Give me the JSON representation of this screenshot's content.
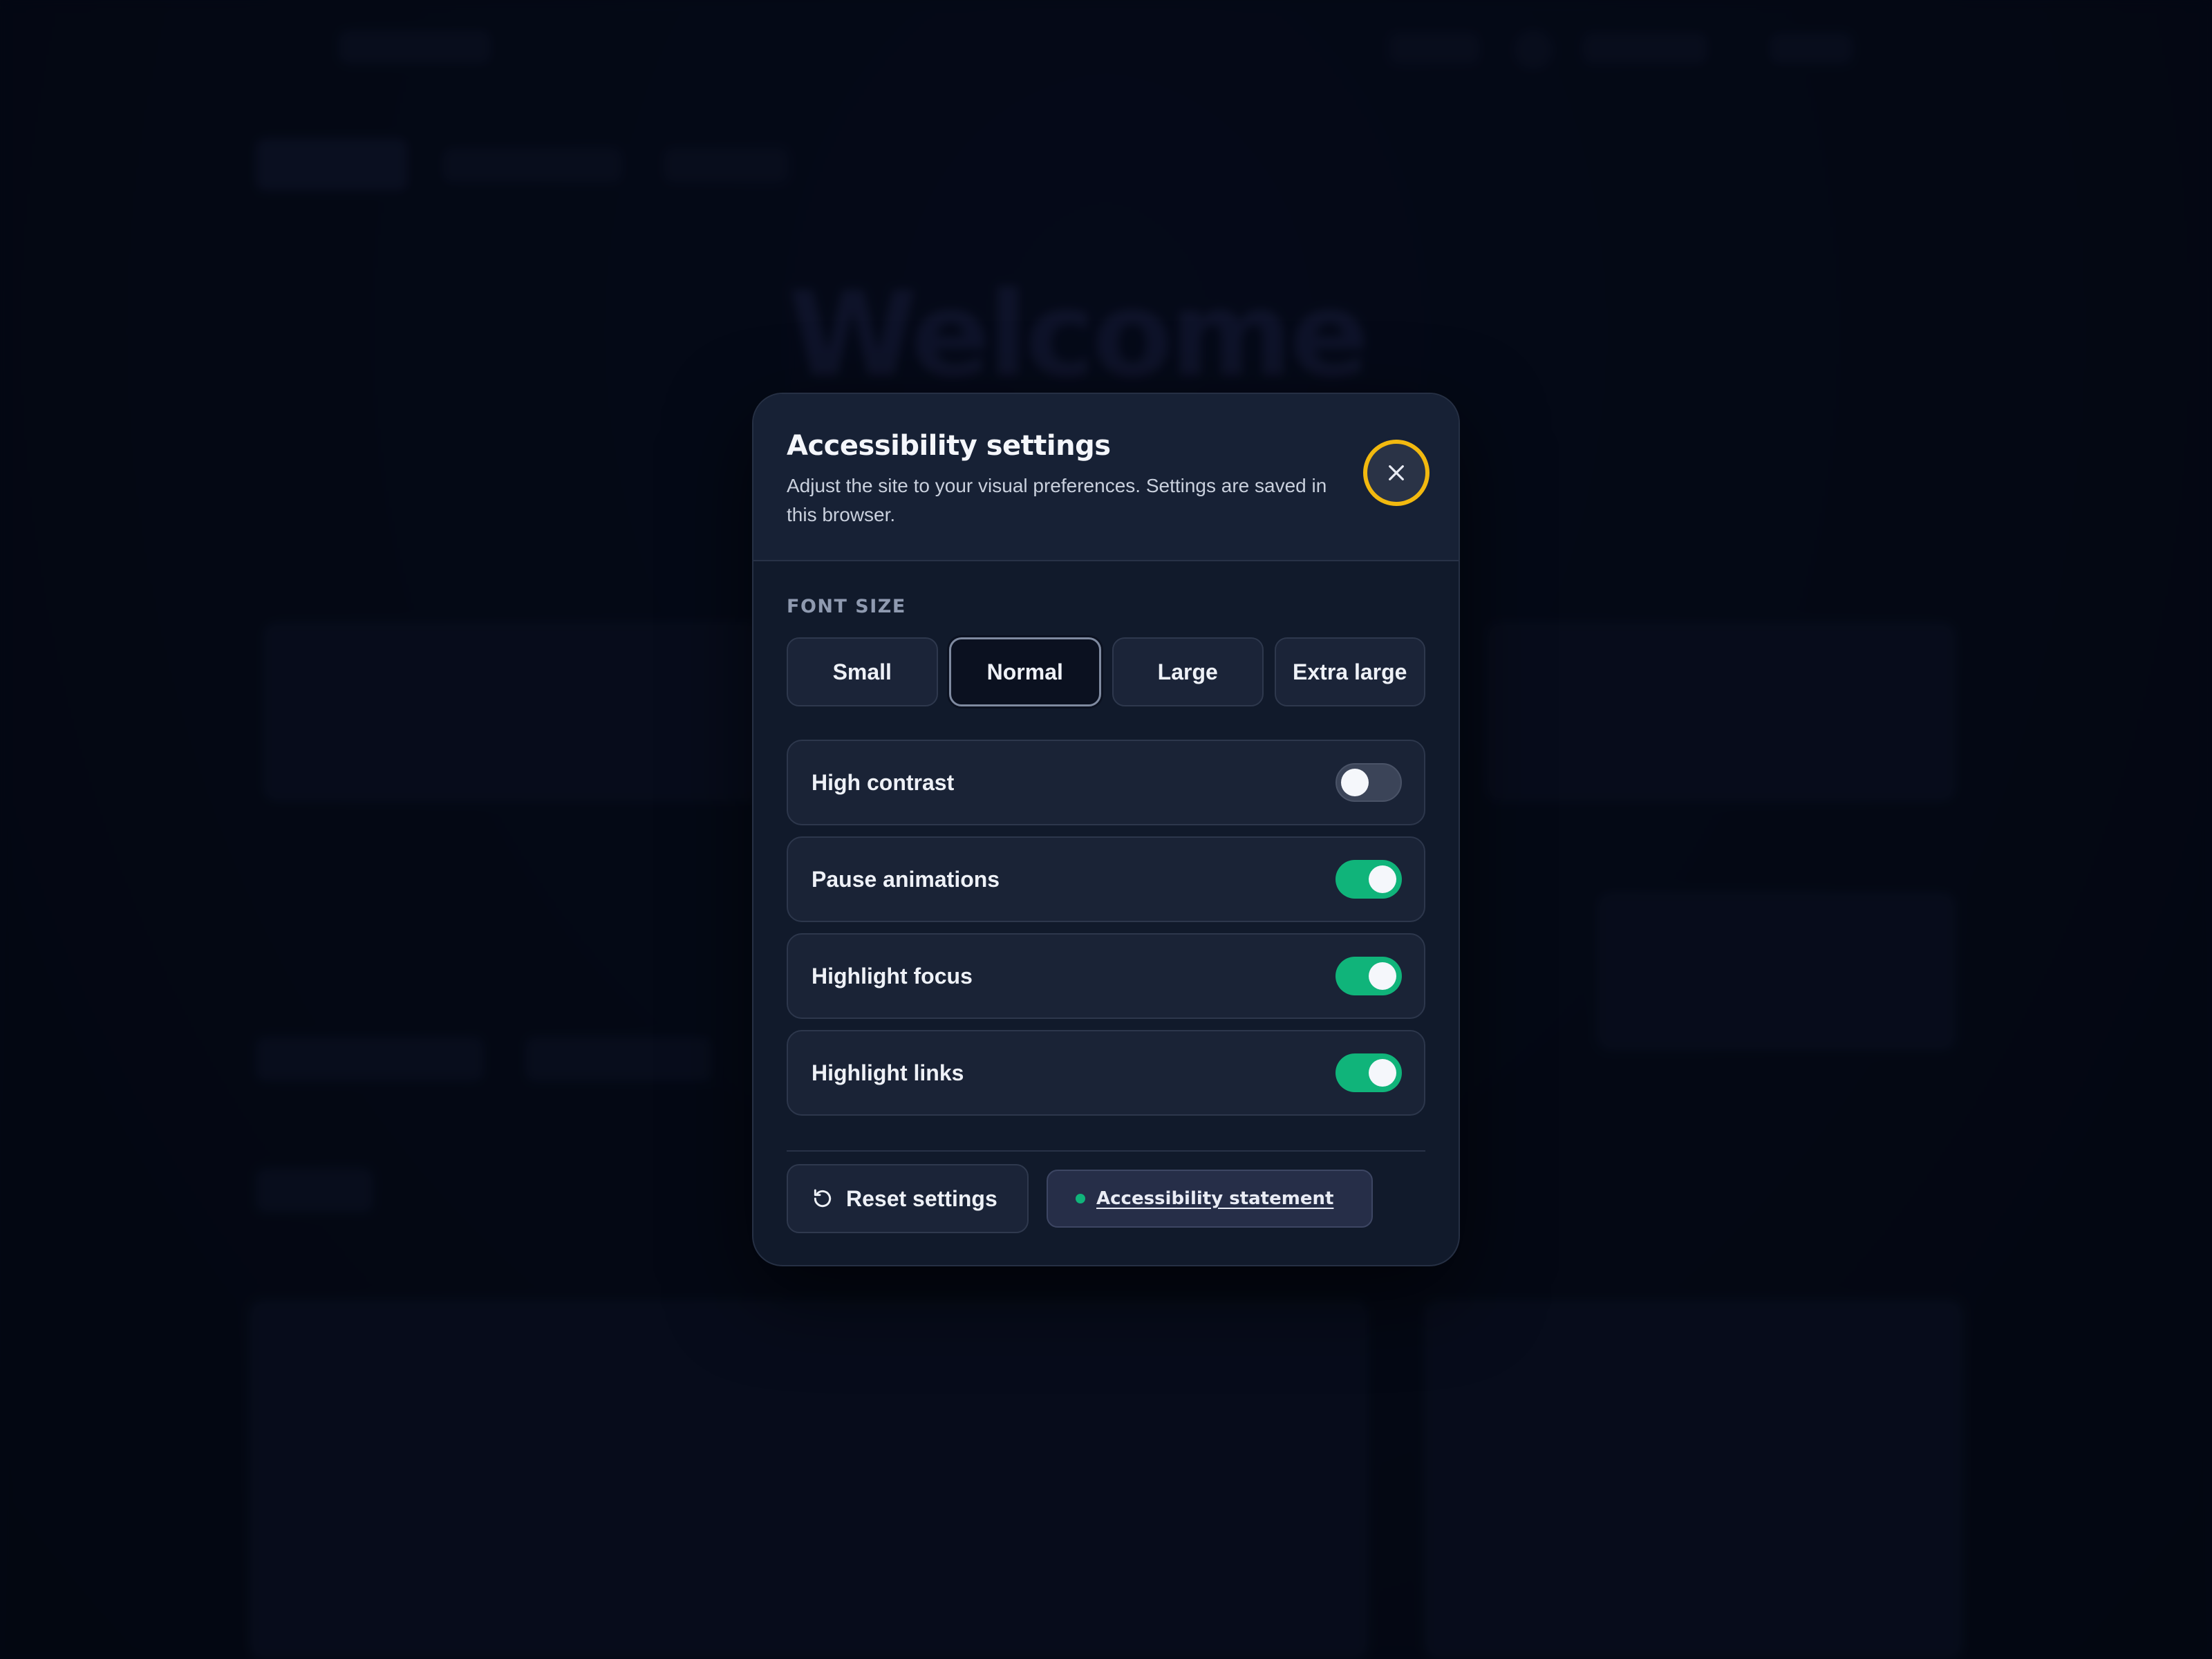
{
  "dialog": {
    "title": "Accessibility settings",
    "description": "Adjust the site to your visual preferences. Settings are saved in this browser.",
    "close_icon": "close-icon"
  },
  "font_size": {
    "label": "FONT SIZE",
    "options": [
      "Small",
      "Normal",
      "Large",
      "Extra large"
    ],
    "selected": "Normal"
  },
  "toggles": [
    {
      "label": "High contrast",
      "on": false
    },
    {
      "label": "Pause animations",
      "on": true
    },
    {
      "label": "Highlight focus",
      "on": true
    },
    {
      "label": "Highlight links",
      "on": true
    }
  ],
  "footer": {
    "reset_label": "Reset settings",
    "reset_icon": "reset-icon",
    "statement_label": "Accessibility statement"
  },
  "background": {
    "welcome_text": "Welcome !"
  },
  "colors": {
    "accent_focus": "#f2b90f",
    "toggle_on": "#10b47a",
    "toggle_off": "#3b4458"
  }
}
